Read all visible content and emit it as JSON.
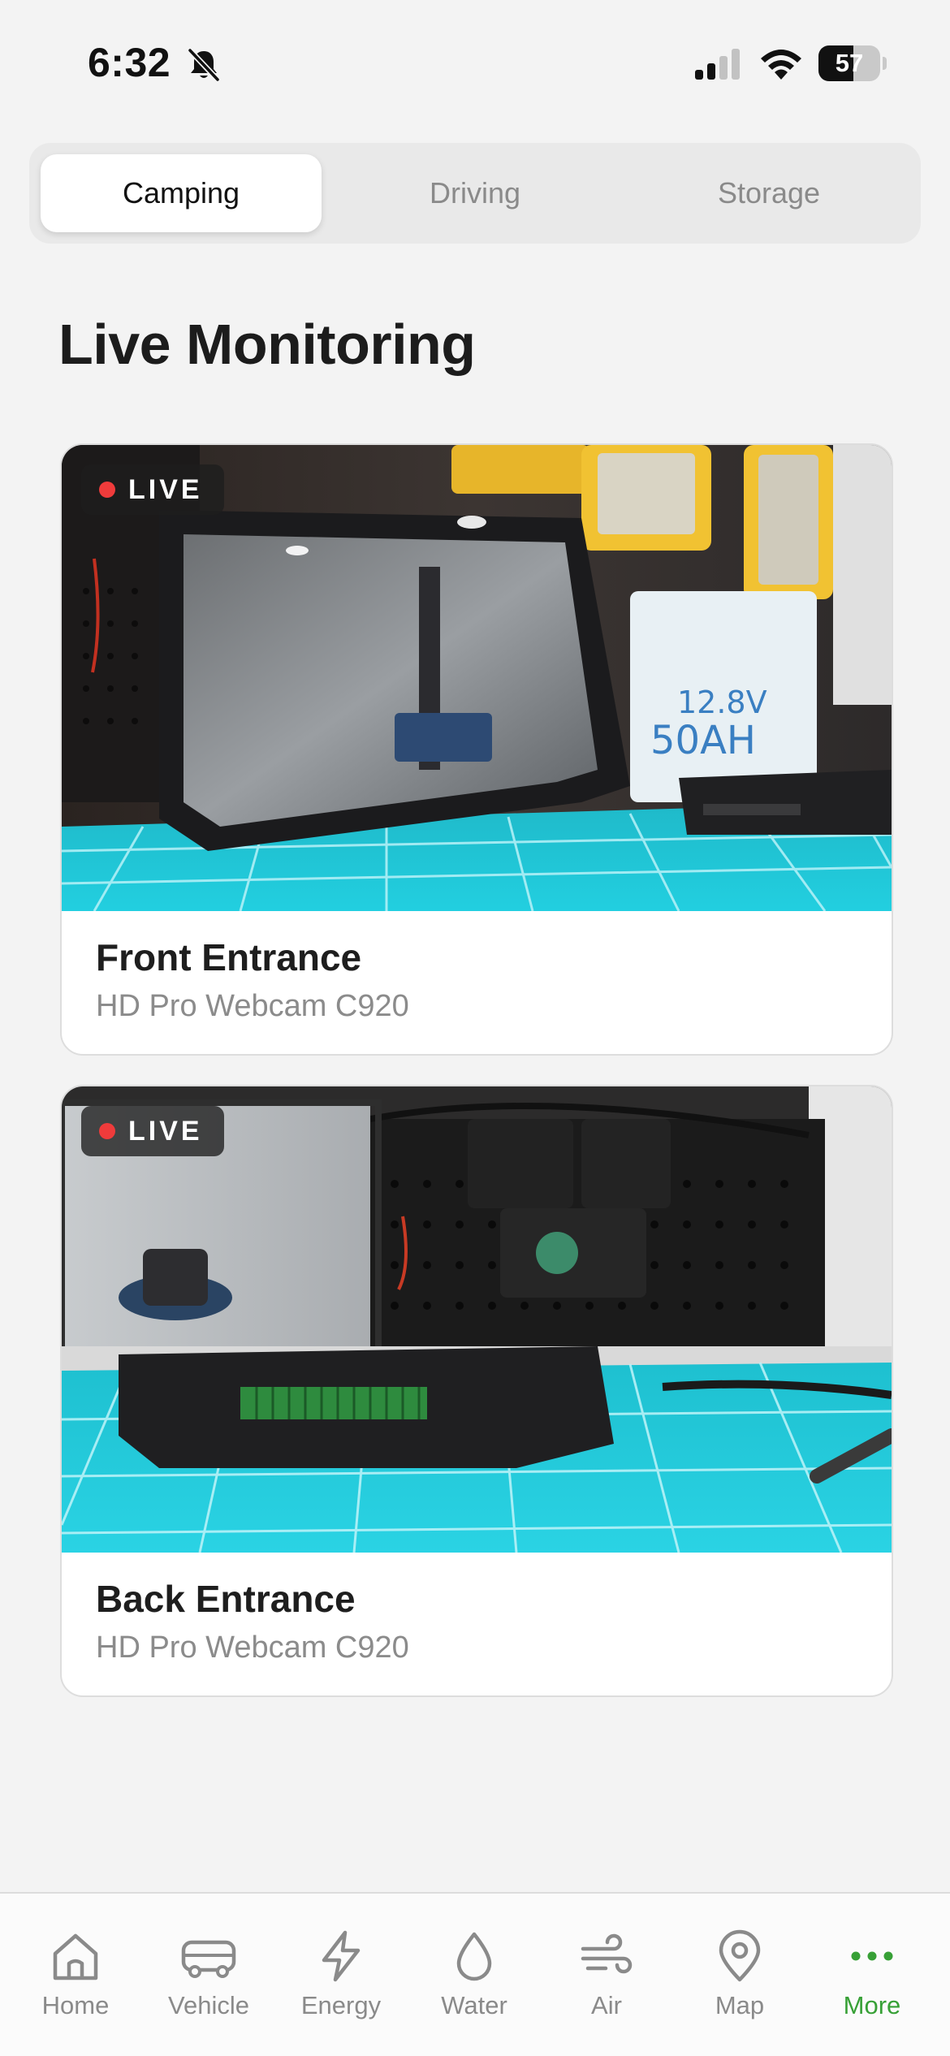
{
  "status_bar": {
    "time": "6:32",
    "battery_level": 57,
    "silent_mode_icon": "bell-slash-icon",
    "signal_icon": "cellular-signal-icon",
    "wifi_icon": "wifi-icon"
  },
  "segments": {
    "selected": "Camping",
    "tabs": [
      {
        "label": "Camping"
      },
      {
        "label": "Driving"
      },
      {
        "label": "Storage"
      }
    ]
  },
  "section": {
    "title": "Live Monitoring"
  },
  "cameras": [
    {
      "badge": "LIVE",
      "name": "Front Entrance",
      "model": "HD Pro Webcam C920"
    },
    {
      "badge": "LIVE",
      "name": "Back Entrance",
      "model": "HD Pro Webcam C920"
    }
  ],
  "tab_bar": {
    "active": "More",
    "items": [
      {
        "label": "Home",
        "icon": "house-icon"
      },
      {
        "label": "Vehicle",
        "icon": "van-icon"
      },
      {
        "label": "Energy",
        "icon": "lightning-icon"
      },
      {
        "label": "Water",
        "icon": "droplet-icon"
      },
      {
        "label": "Air",
        "icon": "wind-icon"
      },
      {
        "label": "Map",
        "icon": "map-pin-icon"
      },
      {
        "label": "More",
        "icon": "ellipsis-icon"
      }
    ]
  },
  "colors": {
    "accent_green": "#37a036",
    "live_dot_red": "#ef3b3b",
    "inactive_gray": "#8a8a8a",
    "background": "#f3f3f3"
  }
}
